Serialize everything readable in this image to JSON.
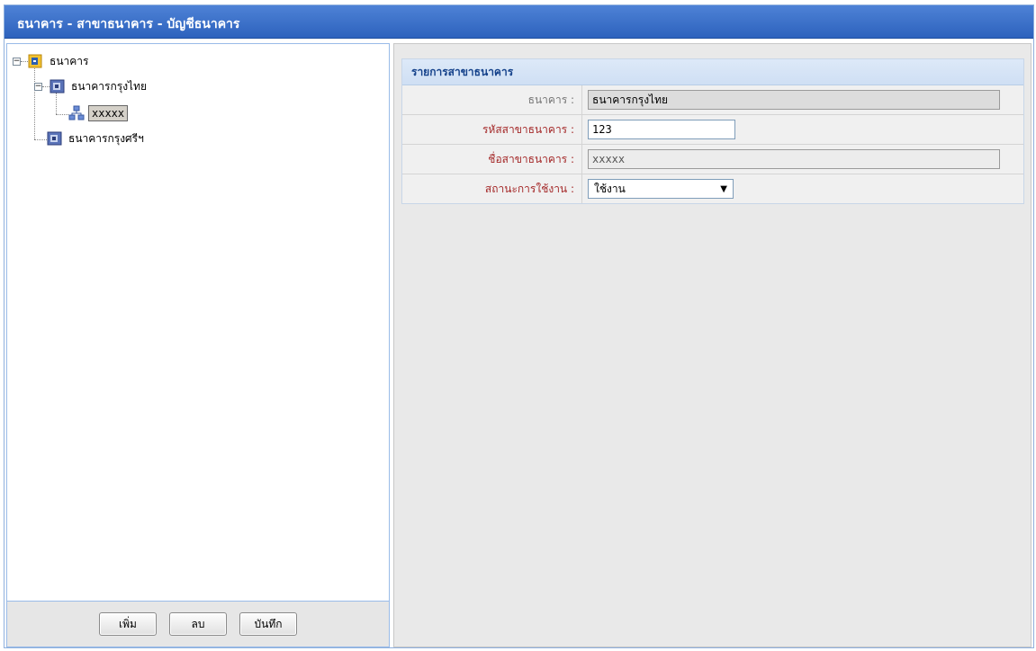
{
  "window": {
    "title": "ธนาคาร - สาขาธนาคาร - บัญชีธนาคาร"
  },
  "tree": {
    "root": {
      "label": "ธนาคาร"
    },
    "bank1": {
      "label": "ธนาคารกรุงไทย"
    },
    "branch1": {
      "label": "xxxxx"
    },
    "bank2": {
      "label": "ธนาคารกรุงศรีฯ"
    }
  },
  "buttons": {
    "add": "เพิ่ม",
    "delete": "ลบ",
    "save": "บันทึก"
  },
  "form": {
    "header": "รายการสาขาธนาคาร",
    "bank_label": "ธนาคาร :",
    "bank_value": "ธนาคารกรุงไทย",
    "branch_code_label": "รหัสสาขาธนาคาร :",
    "branch_code_value": "123",
    "branch_name_label": "ชื่อสาขาธนาคาร :",
    "branch_name_value": "xxxxx",
    "status_label": "สถานะการใช้งาน :",
    "status_value": "ใช้งาน"
  },
  "colors": {
    "title_bar": "#3b6fca",
    "required_label": "#a52a2a",
    "panel_header": "#15428b"
  }
}
